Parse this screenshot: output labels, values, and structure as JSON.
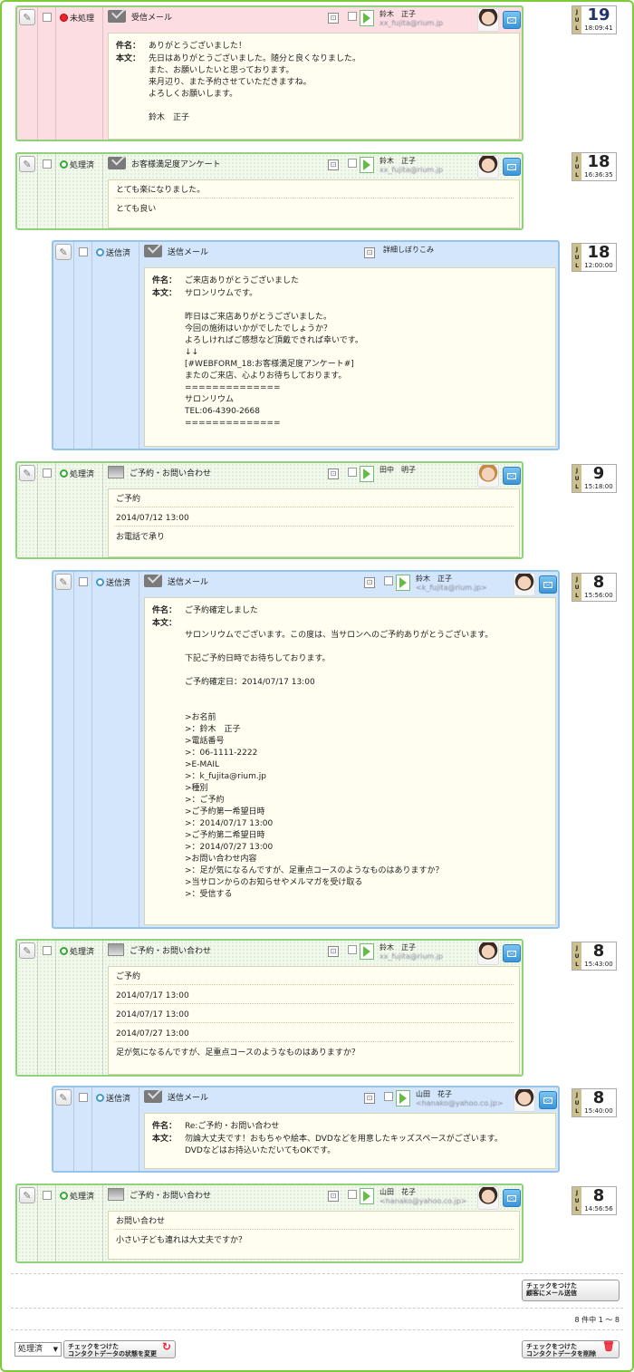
{
  "entries": [
    {
      "status": "未処理",
      "type": "受信メール",
      "contact_name": "鈴木　正子",
      "contact_email": "xx_fujita@rium.jp",
      "day": "19",
      "month": "JUL",
      "time": "18:09:41",
      "subject_label": "件名：",
      "subject": "ありがとうございました！",
      "body_label": "本文：",
      "body": "先日はありがとうございました。随分と良くなりました。\nまた、お願いしたいと思っております。\n来月辺り、また予約させていただきますね。\nよろしくお願いします。\n\n鈴木　正子"
    },
    {
      "status": "処理済",
      "type": "お客様満足度アンケート",
      "contact_name": "鈴木　正子",
      "contact_email": "xx_fujita@rium.jp",
      "day": "18",
      "month": "JUL",
      "time": "16:36:35",
      "rows": [
        "とても楽になりました。",
        "とても良い"
      ]
    },
    {
      "status": "送信済",
      "type": "送信メール",
      "contact_name": "詳細しぼりこみ",
      "contact_email": "",
      "day": "18",
      "month": "JUL",
      "time": "12:00:00",
      "subject_label": "件名：",
      "subject": "ご来店ありがとうございました",
      "body_label": "本文：",
      "body": "サロンリウムです。\n\n昨日はご来店ありがとうございました。\n今回の施術はいかがでしたでしょうか？\nよろしければご感想など頂戴できれば幸いです。\n↓↓\n[#WEBFORM_18:お客様満足度アンケート#]\nまたのご来店、心よりお待ちしております。\n==============\nサロンリウム\nTEL:06-4390-2668\n=============="
    },
    {
      "status": "処理済",
      "type": "ご予約・お問い合わせ",
      "contact_name": "田中　明子",
      "contact_email": "",
      "day": "9",
      "month": "JUL",
      "time": "15:18:00",
      "rows": [
        "ご予約",
        "2014/07/12 13:00",
        "お電話で承り"
      ]
    },
    {
      "status": "送信済",
      "type": "送信メール",
      "contact_name": "鈴木　正子",
      "contact_email": "<k_fujita@rium.jp>",
      "day": "8",
      "month": "JUL",
      "time": "15:56:00",
      "subject_label": "件名：",
      "subject": "ご予約確定しました",
      "body_label": "本文：",
      "body": "\nサロンリウムでございます。この度は、当サロンへのご予約ありがとうございます。\n\n下記ご予約日時でお待ちしております。\n\nご予約確定日：2014/07/17 13:00\n\n\n>お名前\n>：鈴木　正子\n>電話番号\n>：06-1111-2222\n>E-MAIL\n>：k_fujita@rium.jp\n>種別\n>：ご予約\n>ご予約第一希望日時\n>：2014/07/17 13:00\n>ご予約第二希望日時\n>：2014/07/27 13:00\n>お問い合わせ内容\n>：足が気になるんですが、足重点コースのようなものはありますか？\n>当サロンからのお知らせやメルマガを受け取る\n>：受信する"
    },
    {
      "status": "処理済",
      "type": "ご予約・お問い合わせ",
      "contact_name": "鈴木　正子",
      "contact_email": "xx_fujita@rium.jp",
      "day": "8",
      "month": "JUL",
      "time": "15:43:00",
      "rows": [
        "ご予約",
        "2014/07/17 13:00",
        "2014/07/17 13:00",
        "2014/07/27 13:00",
        "足が気になるんですが、足重点コースのようなものはありますか？"
      ]
    },
    {
      "status": "送信済",
      "type": "送信メール",
      "contact_name": "山田　花子",
      "contact_email": "<hanako@yahoo.co.jp>",
      "day": "8",
      "month": "JUL",
      "time": "15:40:00",
      "subject_label": "件名：",
      "subject": "Re:ご予約・お問い合わせ",
      "body_label": "本文：",
      "body": "勿論大丈夫です！おもちゃや絵本、DVDなどを用意したキッズスペースがございます。\nDVDなどはお持込いただいてもOKです。"
    },
    {
      "status": "処理済",
      "type": "ご予約・お問い合わせ",
      "contact_name": "山田　花子",
      "contact_email": "<hanako@yahoo.co.jp>",
      "day": "8",
      "month": "JUL",
      "time": "14:56:56",
      "rows": [
        "お問い合わせ",
        "小さい子ども連れは大丈夫ですか？"
      ]
    }
  ],
  "footer": {
    "send_mail_button": "チェックをつけた\n顧客にメール送信",
    "pagination": "8 件中 1 ～ 8",
    "status_select": "処理済",
    "change_status_button": "チェックをつけた\nコンタクトデータの状態を変更",
    "delete_button": "チェックをつけた\nコンタクトデータを削除"
  },
  "colors": {
    "unprocessed_bg": "#fbdde2",
    "processed_bg": "#f1f8ec",
    "sent_bg": "#d3e6fb",
    "frame_green": "#7ccc3a"
  }
}
